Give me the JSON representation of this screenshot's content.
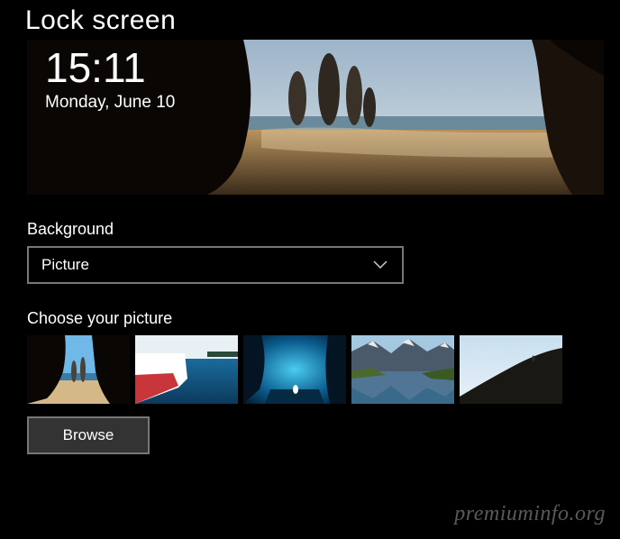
{
  "page": {
    "title": "Lock screen"
  },
  "preview": {
    "time": "15:11",
    "date": "Monday, June 10"
  },
  "background": {
    "label": "Background",
    "dropdown_value": "Picture"
  },
  "choose": {
    "label": "Choose your picture",
    "thumbnails": [
      {
        "name": "beach-cave"
      },
      {
        "name": "boat-ocean"
      },
      {
        "name": "ice-cave"
      },
      {
        "name": "mountain-lake"
      },
      {
        "name": "hillside-sky"
      }
    ],
    "browse_label": "Browse"
  },
  "watermark": "premiuminfo.org"
}
